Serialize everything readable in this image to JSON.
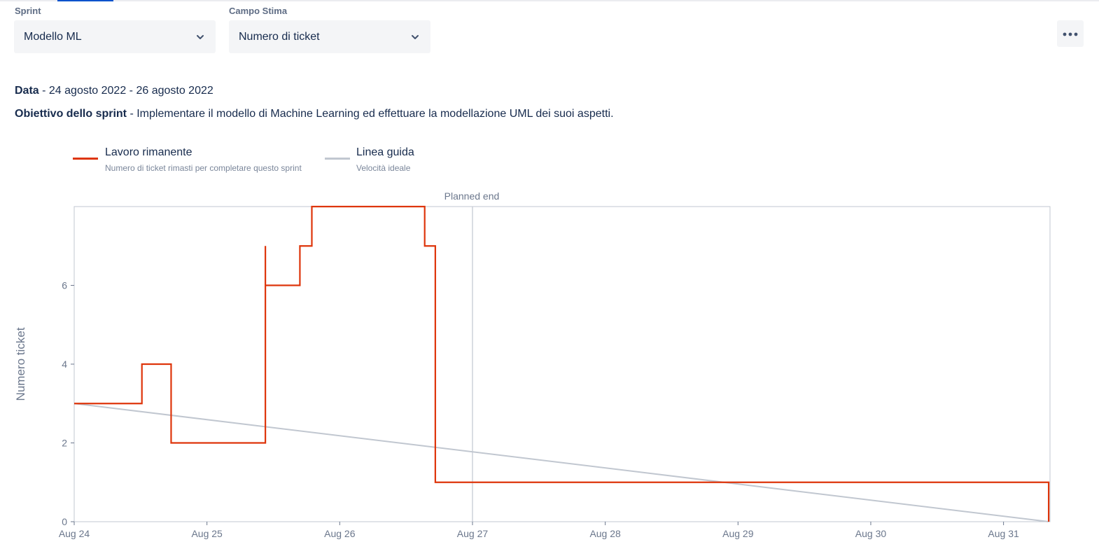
{
  "filters": {
    "sprint": {
      "label": "Sprint",
      "value": "Modello ML"
    },
    "estimate": {
      "label": "Campo Stima",
      "value": "Numero di ticket"
    }
  },
  "icons": {
    "dropdown": "chevron-down-icon",
    "more": "more-horizontal-icon"
  },
  "info": {
    "date_label": "Data",
    "date_value": " - 24 agosto 2022 - 26 agosto 2022",
    "goal_label": "Obiettivo dello sprint",
    "goal_value": " - Implementare il modello di Machine Learning ed effettuare la modellazione UML dei suoi aspetti."
  },
  "legend": [
    {
      "title": "Lavoro rimanente",
      "subtitle": "Numero di ticket rimasti per completare questo sprint",
      "color": "#de350b"
    },
    {
      "title": "Linea guida",
      "subtitle": "Velocità ideale",
      "color": "#c1c7d0"
    }
  ],
  "chart_data": {
    "type": "line",
    "ylabel": "Numero ticket",
    "xlabel": "",
    "annotation": "Planned end",
    "annotation_x": 3.0,
    "x_ticks": [
      "Aug 24",
      "Aug 25",
      "Aug 26",
      "Aug 27",
      "Aug 28",
      "Aug 29",
      "Aug 30",
      "Aug 31"
    ],
    "y_ticks": [
      0,
      2,
      4,
      6
    ],
    "xlim": [
      0,
      7.35
    ],
    "ylim": [
      0,
      8
    ],
    "series": [
      {
        "name": "Lavoro rimanente",
        "color": "#de350b",
        "step": true,
        "points": [
          [
            0,
            3
          ],
          [
            0.51,
            4
          ],
          [
            0.73,
            2
          ],
          [
            1.44,
            7
          ],
          [
            1.44,
            6
          ],
          [
            1.7,
            7
          ],
          [
            1.79,
            8
          ],
          [
            2.64,
            7
          ],
          [
            2.72,
            1
          ],
          [
            7.34,
            0
          ]
        ]
      },
      {
        "name": "Linea guida",
        "color": "#c1c7d0",
        "step": false,
        "points": [
          [
            0,
            3
          ],
          [
            7.34,
            0
          ]
        ]
      }
    ]
  }
}
